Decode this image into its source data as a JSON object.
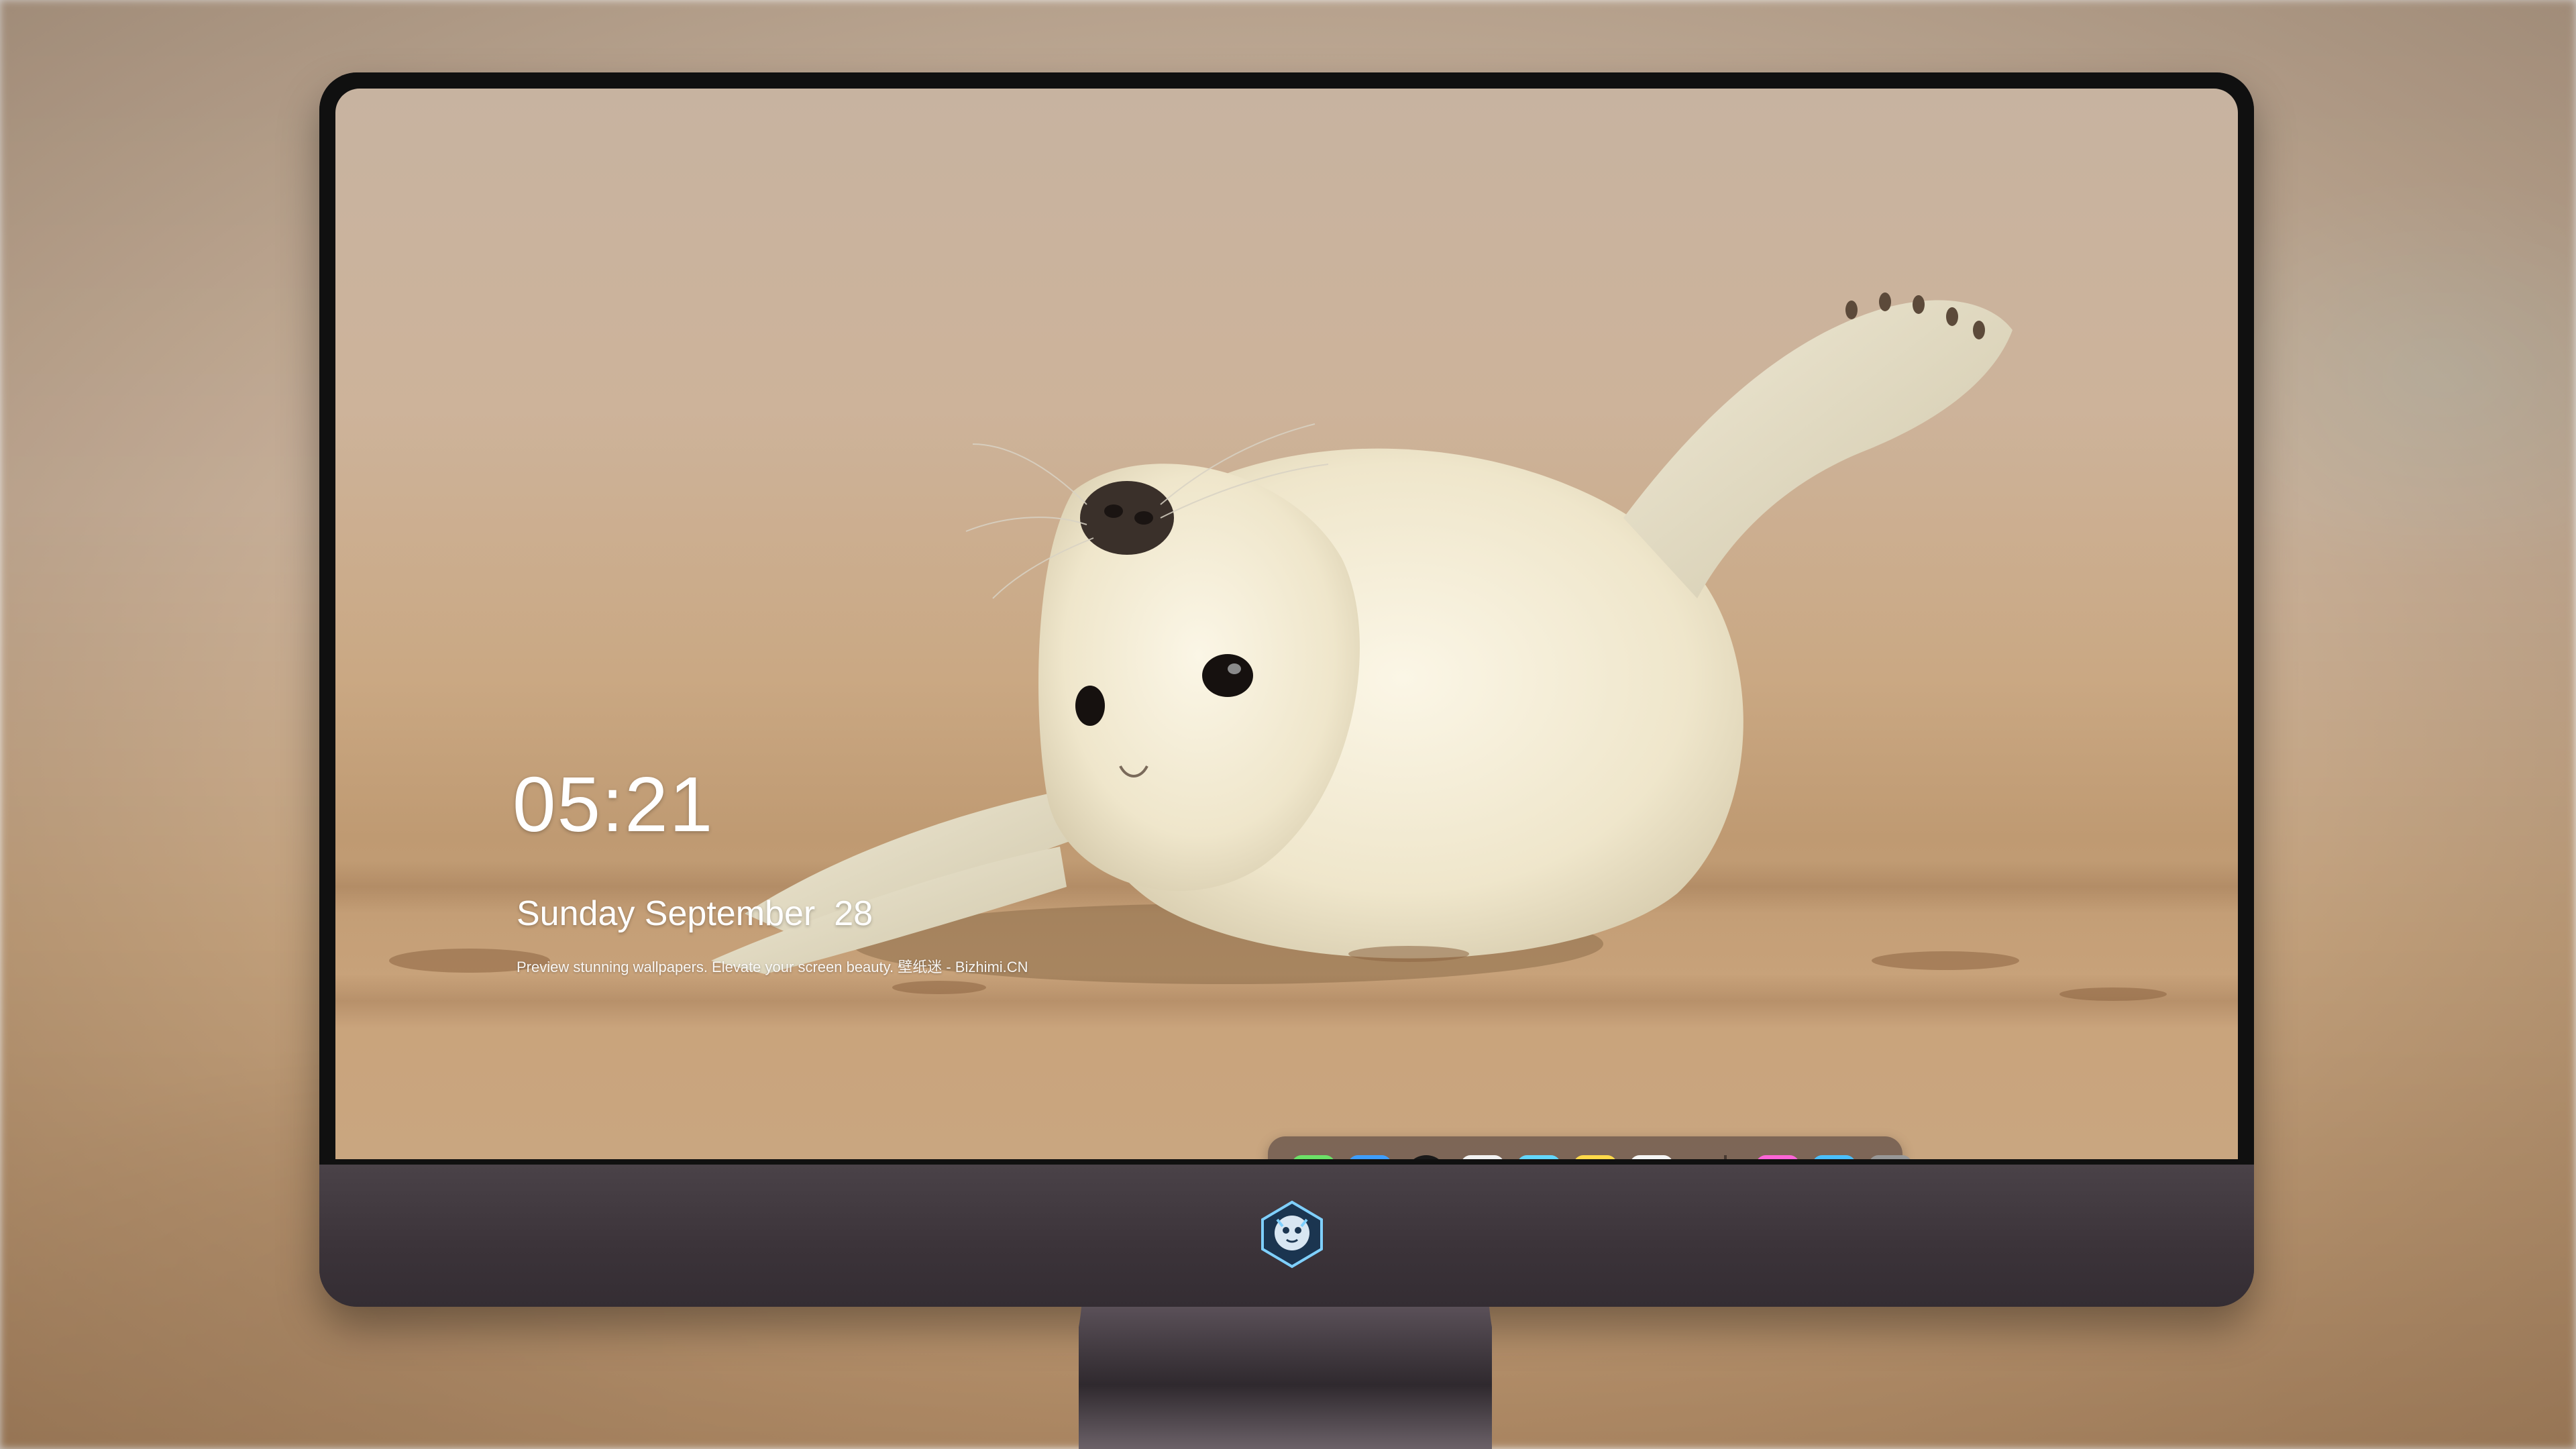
{
  "lock_screen": {
    "time": "05:21",
    "weekday_month": "Sunday September",
    "day": "28",
    "caption": "Preview stunning wallpapers. Elevate your screen beauty. 壁纸迷 - Bizhimi.CN"
  },
  "dock": {
    "apps": [
      {
        "name": "messages-icon"
      },
      {
        "name": "weather-icon"
      },
      {
        "name": "clock-icon"
      },
      {
        "name": "preview-icon"
      },
      {
        "name": "clips-icon"
      },
      {
        "name": "notes-icon"
      },
      {
        "name": "photos-icon"
      },
      {
        "name": "music-icon"
      },
      {
        "name": "app-store-icon"
      },
      {
        "name": "camera-icon"
      }
    ]
  },
  "monitor": {
    "chin_logo": "monitor-logo-icon"
  },
  "colors": {
    "screen_text": "#ffffff",
    "bezel": "#101010",
    "chin": "#3b3339",
    "dock_bg": "#5f4e46"
  }
}
